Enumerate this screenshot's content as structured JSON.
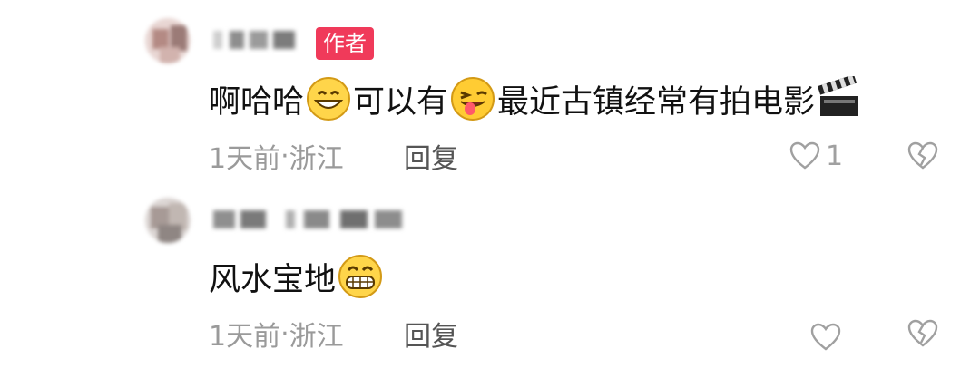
{
  "comments": [
    {
      "author_badge": "作者",
      "text_parts": [
        "啊哈哈",
        "可以有",
        "最近古镇经常有拍电影"
      ],
      "emojis": [
        "grinning-face-emoji",
        "winking-tongue-emoji",
        "clapper-board-emoji"
      ],
      "time": "1天前",
      "separator": "·",
      "location": "浙江",
      "reply_label": "回复",
      "like_count": "1"
    },
    {
      "text_parts": [
        "风水宝地"
      ],
      "emojis": [
        "big-grin-emoji"
      ],
      "time": "1天前",
      "separator": "·",
      "location": "浙江",
      "reply_label": "回复",
      "like_count": ""
    }
  ],
  "colors": {
    "badge_bg": "#f03a5a",
    "meta_text": "#9a9a9a",
    "reply_text": "#555555",
    "icon_gray": "#a0a0a0"
  }
}
